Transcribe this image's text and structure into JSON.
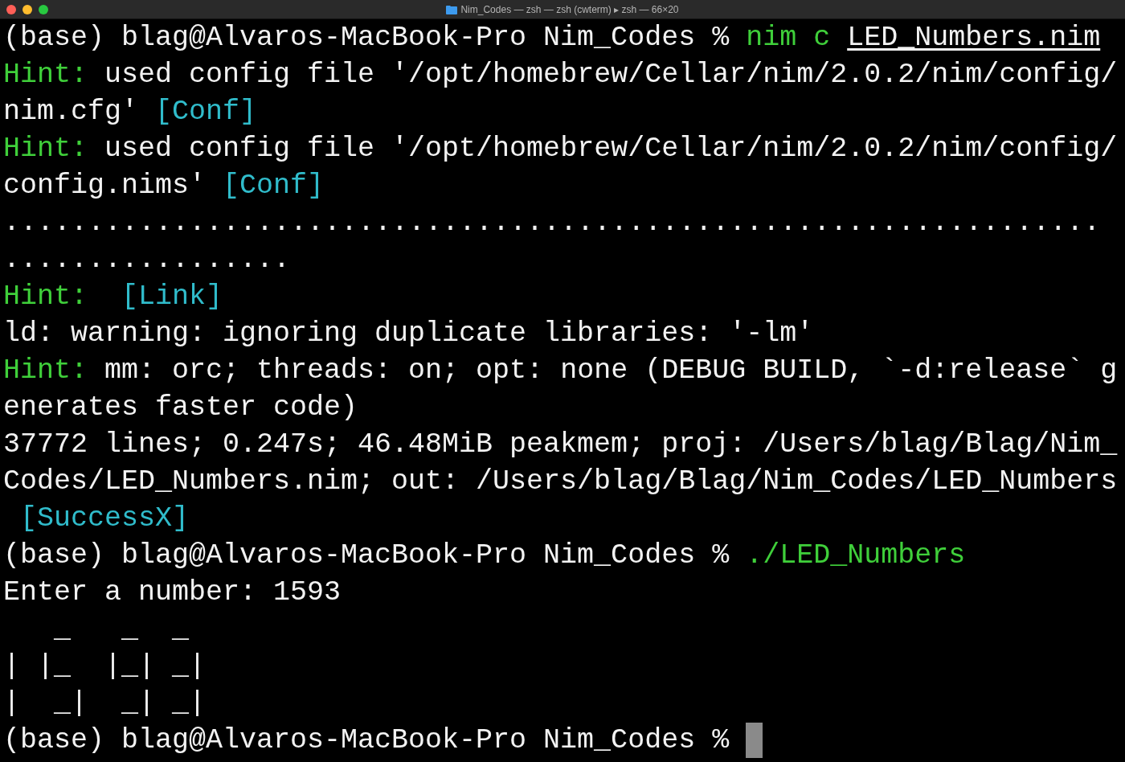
{
  "window": {
    "title": "Nim_Codes — zsh — zsh (cwterm) ▸ zsh — 66×20"
  },
  "terminal": {
    "cursor": true,
    "lines": [
      {
        "segments": [
          {
            "kind": "prompt",
            "text": "(base) blag@Alvaros-MacBook-Pro Nim_Codes % "
          },
          {
            "kind": "command",
            "text": "nim c "
          },
          {
            "kind": "file",
            "text": "LED_Numbers.nim"
          }
        ]
      },
      {
        "segments": [
          {
            "kind": "hint",
            "text": "Hint:"
          },
          {
            "kind": "plain",
            "text": " used config file '/opt/homebrew/Cellar/nim/2.0.2/nim/config/"
          }
        ]
      },
      {
        "segments": [
          {
            "kind": "plain",
            "text": "nim.cfg' "
          },
          {
            "kind": "tag",
            "text": "[Conf]"
          }
        ]
      },
      {
        "segments": [
          {
            "kind": "hint",
            "text": "Hint:"
          },
          {
            "kind": "plain",
            "text": " used config file '/opt/homebrew/Cellar/nim/2.0.2/nim/config/"
          }
        ]
      },
      {
        "segments": [
          {
            "kind": "plain",
            "text": "config.nims' "
          },
          {
            "kind": "tag",
            "text": "[Conf]"
          }
        ]
      },
      {
        "segments": [
          {
            "kind": "plain",
            "text": "................................................................."
          }
        ]
      },
      {
        "segments": [
          {
            "kind": "plain",
            "text": "................."
          }
        ]
      },
      {
        "segments": [
          {
            "kind": "hint",
            "text": "Hint:"
          },
          {
            "kind": "tag",
            "text": "  [Link]"
          }
        ]
      },
      {
        "segments": [
          {
            "kind": "plain",
            "text": "ld: warning: ignoring duplicate libraries: '-lm'"
          }
        ]
      },
      {
        "segments": [
          {
            "kind": "hint",
            "text": "Hint:"
          },
          {
            "kind": "plain",
            "text": " mm: orc; threads: on; opt: none (DEBUG BUILD, `-d:release` g"
          }
        ]
      },
      {
        "segments": [
          {
            "kind": "plain",
            "text": "enerates faster code)"
          }
        ]
      },
      {
        "segments": [
          {
            "kind": "plain",
            "text": "37772 lines; 0.247s; 46.48MiB peakmem; proj: /Users/blag/Blag/Nim_"
          }
        ]
      },
      {
        "segments": [
          {
            "kind": "plain",
            "text": "Codes/LED_Numbers.nim; out: /Users/blag/Blag/Nim_Codes/LED_Numbers"
          }
        ]
      },
      {
        "segments": [
          {
            "kind": "tag",
            "text": " [SuccessX]"
          }
        ]
      },
      {
        "segments": [
          {
            "kind": "prompt",
            "text": "(base) blag@Alvaros-MacBook-Pro Nim_Codes % "
          },
          {
            "kind": "command",
            "text": "./LED_Numbers"
          }
        ]
      },
      {
        "segments": [
          {
            "kind": "plain",
            "text": "Enter a number: 1593"
          }
        ]
      },
      {
        "segments": [
          {
            "kind": "art",
            "text": "   _   _  _\n| |_  |_| _|\n|  _|  _| _|"
          }
        ]
      },
      {
        "segments": [
          {
            "kind": "prompt",
            "text": "(base) blag@Alvaros-MacBook-Pro Nim_Codes % "
          }
        ]
      }
    ]
  }
}
